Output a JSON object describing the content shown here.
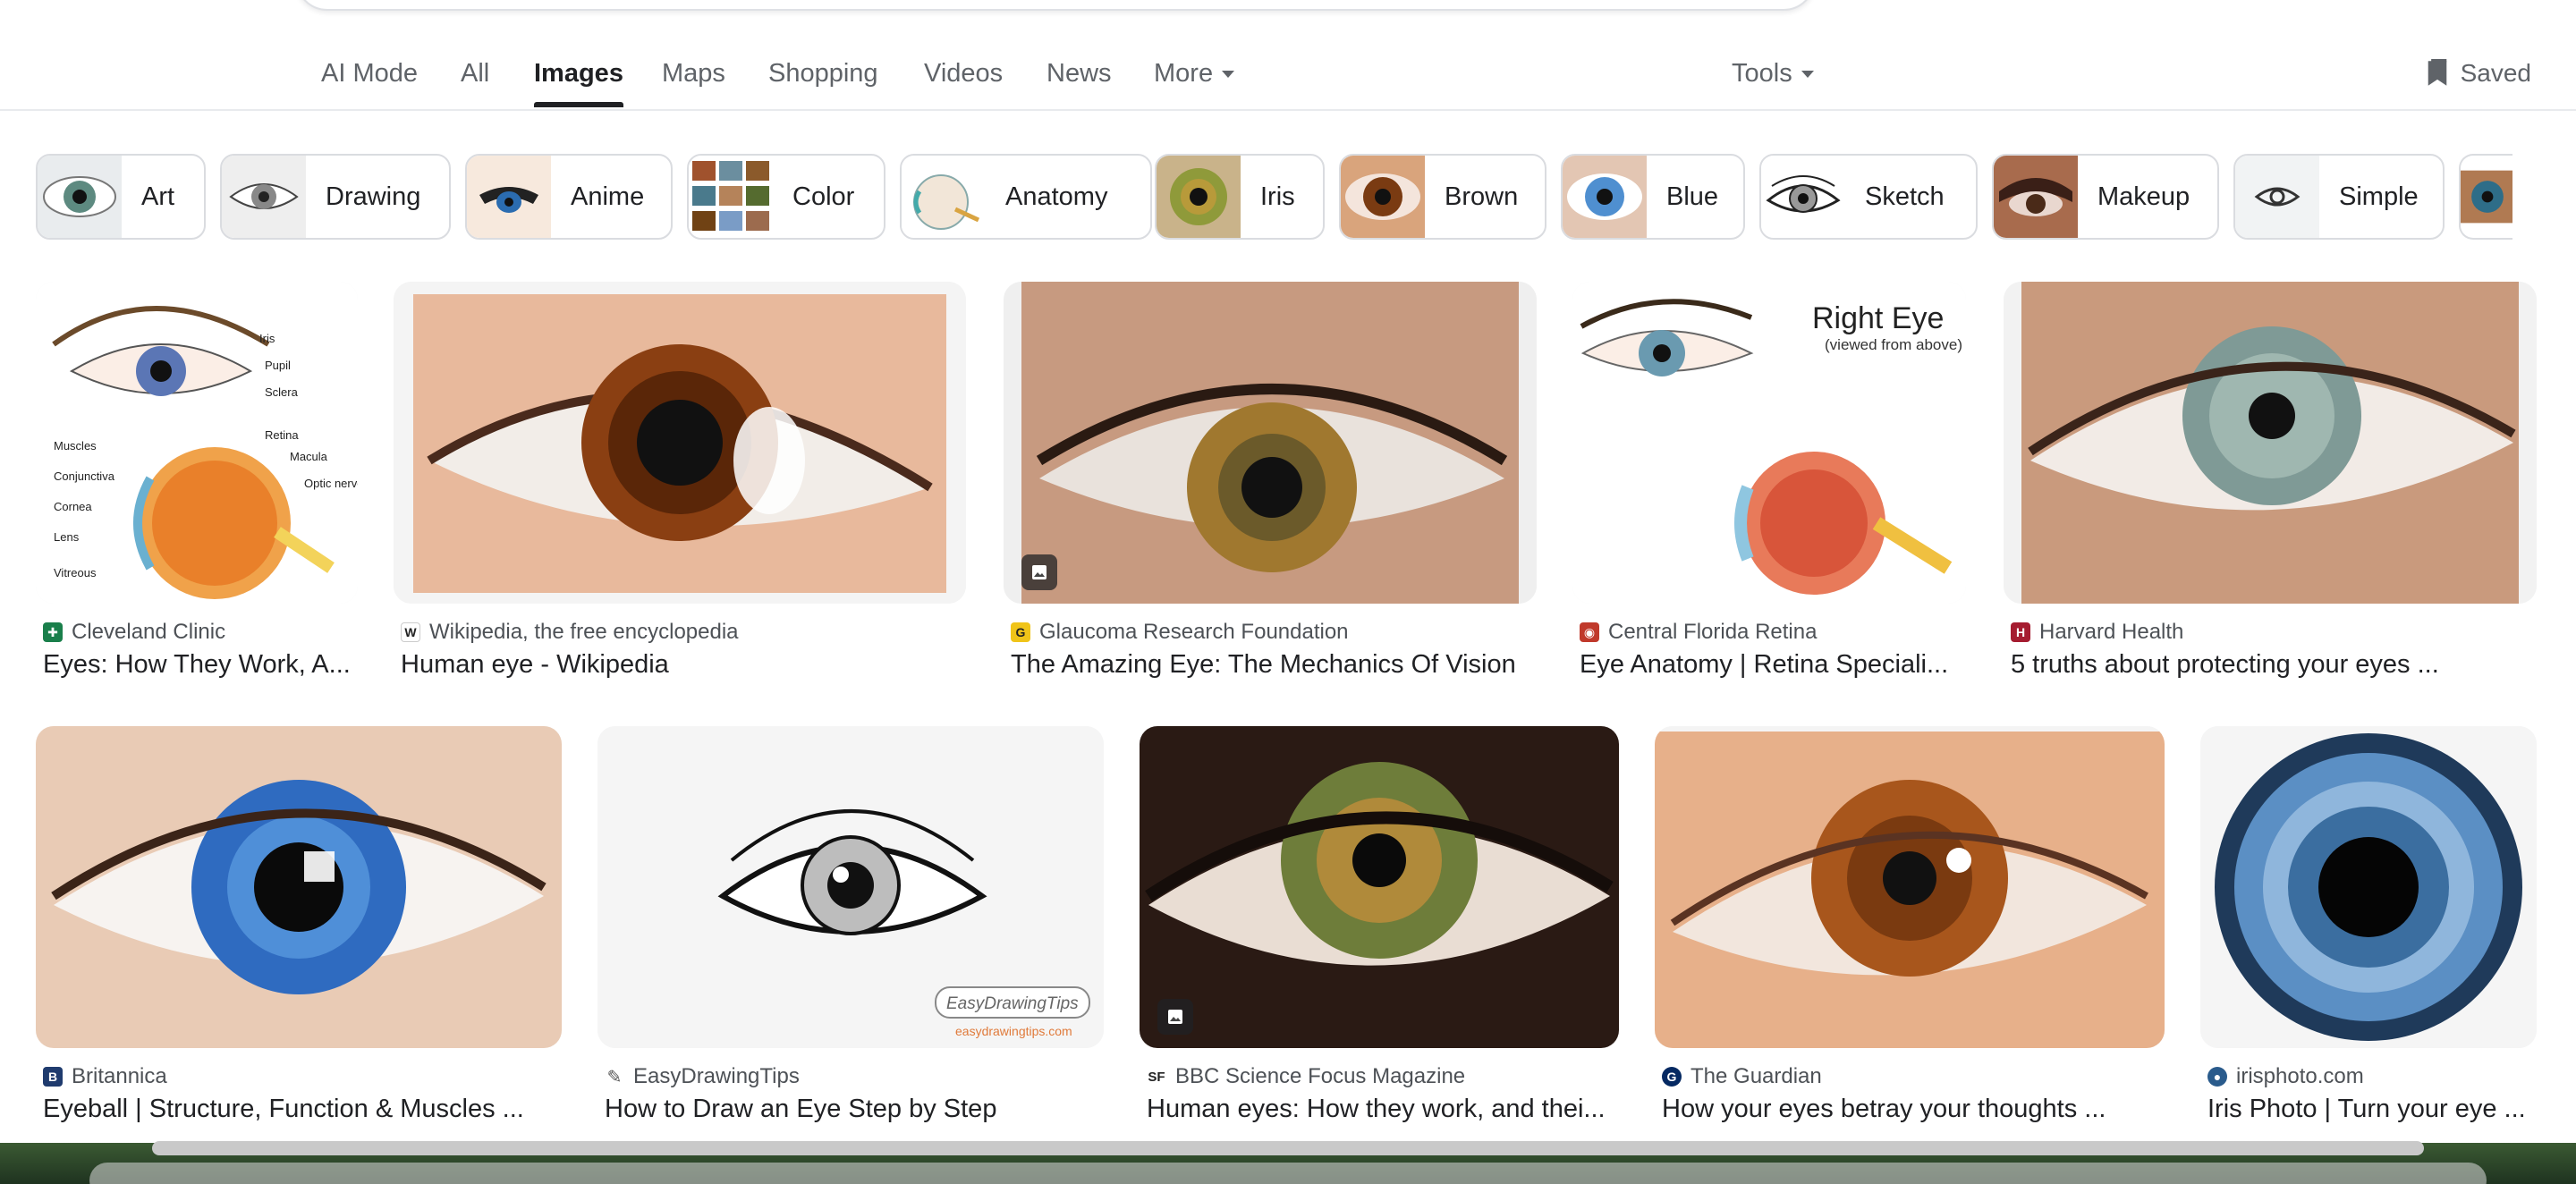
{
  "nav": {
    "tabs": [
      {
        "label": "AI Mode",
        "active": false
      },
      {
        "label": "All",
        "active": false
      },
      {
        "label": "Images",
        "active": true
      },
      {
        "label": "Maps",
        "active": false
      },
      {
        "label": "Shopping",
        "active": false
      },
      {
        "label": "Videos",
        "active": false
      },
      {
        "label": "News",
        "active": false
      },
      {
        "label": "More",
        "active": false
      }
    ],
    "tools_label": "Tools",
    "saved_label": "Saved"
  },
  "chips": [
    {
      "label": "Art"
    },
    {
      "label": "Drawing"
    },
    {
      "label": "Anime"
    },
    {
      "label": "Color"
    },
    {
      "label": "Anatomy"
    },
    {
      "label": "Iris"
    },
    {
      "label": "Brown"
    },
    {
      "label": "Blue"
    },
    {
      "label": "Sketch"
    },
    {
      "label": "Makeup"
    },
    {
      "label": "Simple"
    }
  ],
  "results": [
    {
      "source": "Cleveland Clinic",
      "title": "Eyes: How They Work, A...",
      "has_badge": false
    },
    {
      "source": "Wikipedia, the free encyclopedia",
      "title": "Human eye - Wikipedia",
      "has_badge": false
    },
    {
      "source": "Glaucoma Research Foundation",
      "title": "The Amazing Eye: The Mechanics Of Vision",
      "has_badge": true
    },
    {
      "source": "Central Florida Retina",
      "title": "Eye Anatomy | Retina Speciali...",
      "has_badge": false
    },
    {
      "source": "Harvard Health",
      "title": "5 truths about protecting your eyes ...",
      "has_badge": false
    },
    {
      "source": "Britannica",
      "title": "Eyeball | Structure, Function & Muscles ...",
      "has_badge": false
    },
    {
      "source": "EasyDrawingTips",
      "title": "How to Draw an Eye Step by Step",
      "has_badge": false
    },
    {
      "source": "BBC Science Focus Magazine",
      "title": "Human eyes: How they work, and thei...",
      "has_badge": true
    },
    {
      "source": "The Guardian",
      "title": "How your eyes betray your thoughts ...",
      "has_badge": false
    },
    {
      "source": "irisphoto.com",
      "title": "Iris Photo | Turn your eye ...",
      "has_badge": false
    }
  ],
  "image_text": {
    "anatomy_labels": [
      "Iris",
      "Pupil",
      "Sclera",
      "Retina",
      "Macula",
      "Optic nerve",
      "Muscles",
      "Conjunctiva",
      "Cornea",
      "Lens",
      "Vitreous"
    ],
    "right_eye_title": "Right Eye",
    "right_eye_subtitle": "(viewed from above)",
    "watermark": "EasyDrawingTips",
    "watermark_url": "easydrawingtips.com"
  },
  "colors": {
    "accent_text": "#202124",
    "muted_text": "#5f6368",
    "source_text": "#4d5156",
    "border": "#dadce0"
  }
}
